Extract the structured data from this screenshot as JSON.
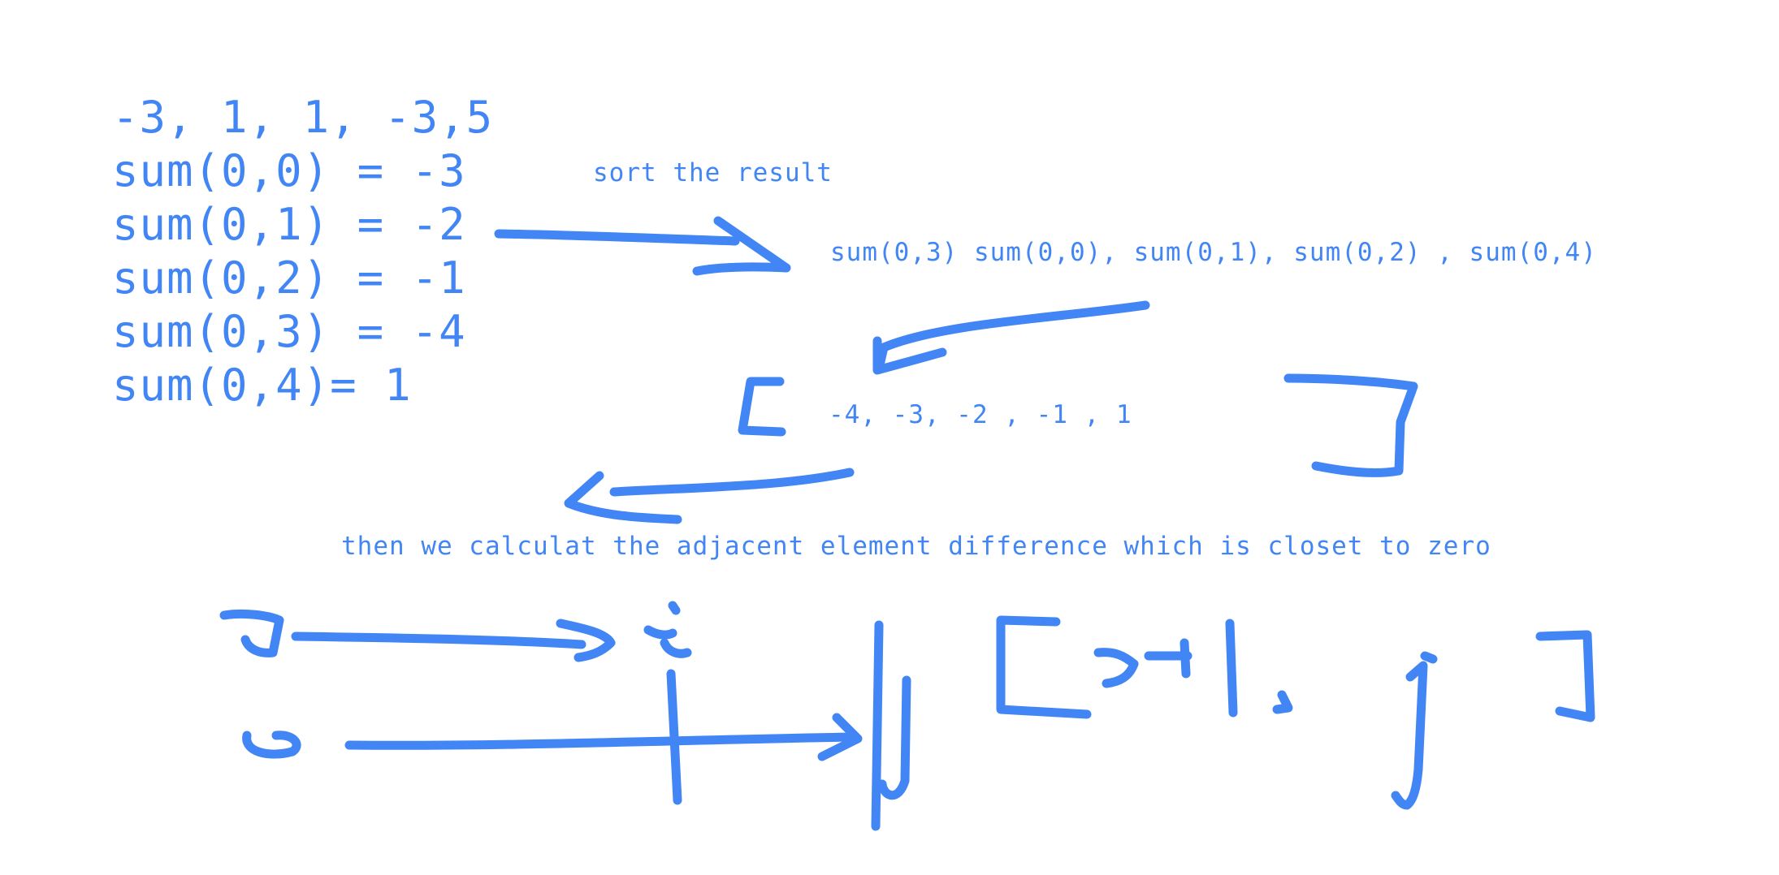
{
  "array_line": "-3, 1, 1, -3,5",
  "prefix_sums": [
    "sum(0,0) = -3",
    "sum(0,1) = -2",
    "sum(0,2) = -1",
    "sum(0,3) = -4",
    "sum(0,4)= 1"
  ],
  "sort_label": "sort the result",
  "sorted_order": "sum(0,3) sum(0,0), sum(0,1), sum(0,2) , sum(0,4)",
  "sorted_values": "-4, -3, -2 , -1 , 1",
  "explanation": "then we calculat the adjacent element difference which is closet to zero",
  "ink_color": "#4285f4"
}
